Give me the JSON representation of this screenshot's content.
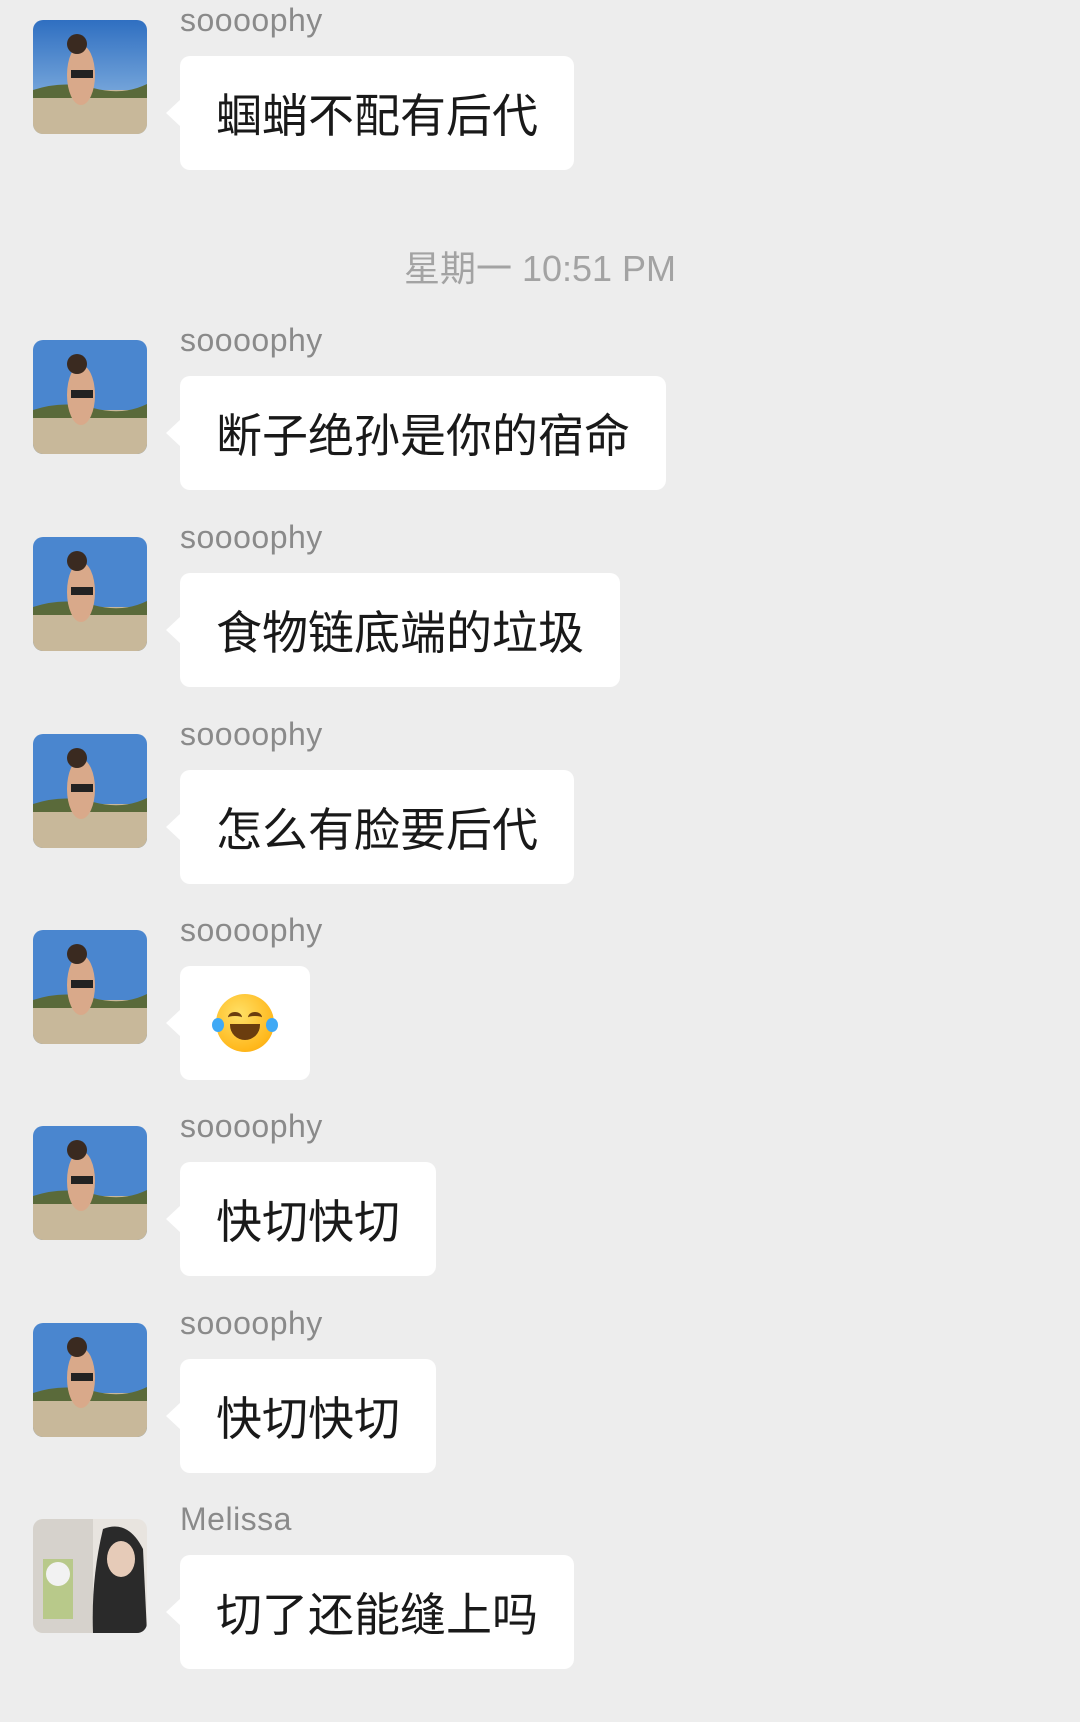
{
  "timestamp": "星期一 10:51 PM",
  "messages": [
    {
      "sender": "soooophy",
      "text": "蝈蛸不配有后代"
    },
    {
      "sender": "soooophy",
      "text": "断子绝孙是你的宿命"
    },
    {
      "sender": "soooophy",
      "text": "食物链底端的垃圾"
    },
    {
      "sender": "soooophy",
      "text": "怎么有脸要后代"
    },
    {
      "sender": "soooophy",
      "emoji": "face-with-tears-of-joy-icon"
    },
    {
      "sender": "soooophy",
      "text": "快切快切"
    },
    {
      "sender": "soooophy",
      "text": "快切快切"
    },
    {
      "sender": "Melissa",
      "text": "切了还能缝上吗"
    }
  ]
}
